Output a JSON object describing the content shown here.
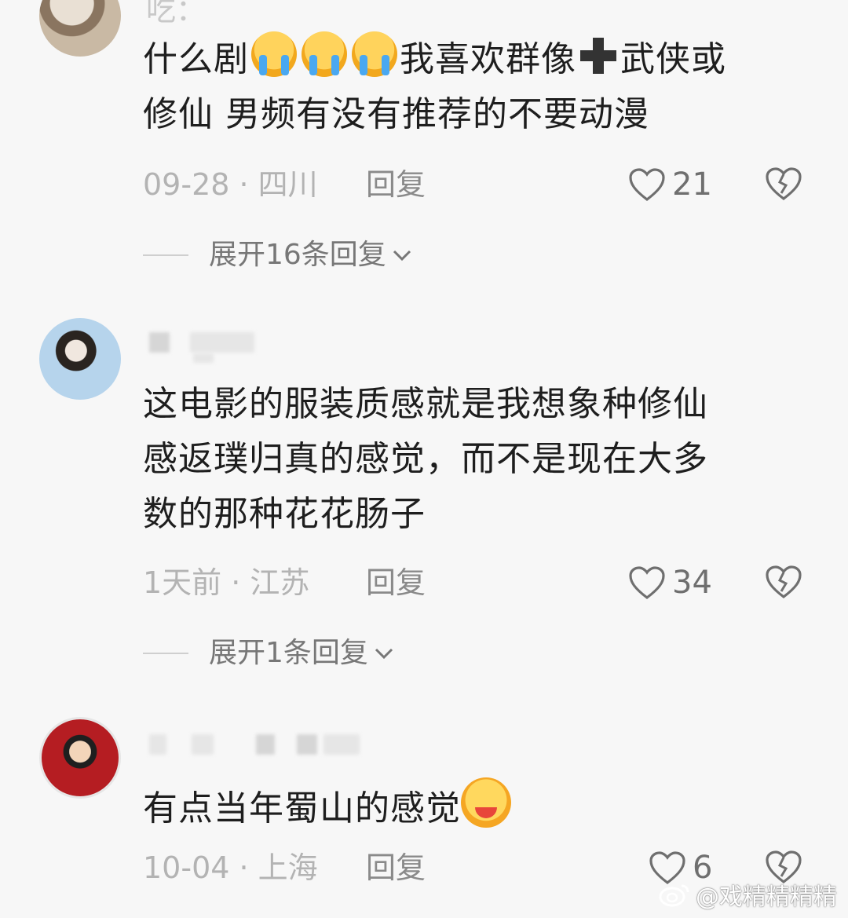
{
  "top_fragment": "吃：",
  "comments": [
    {
      "text_parts": [
        "什么剧",
        "我喜欢群像",
        "武侠或\n修仙 男频有没有推荐的不要动漫"
      ],
      "meta": "09-28 · 四川",
      "reply_label": "回复",
      "likes": "21",
      "expand": "展开16条回复"
    },
    {
      "text": "这电影的服装质感就是我想象种修仙\n感返璞归真的感觉，而不是现在大多\n数的那种花花肠子",
      "meta": "1天前 · 江苏",
      "reply_label": "回复",
      "likes": "34",
      "expand": "展开1条回复"
    },
    {
      "text": "有点当年蜀山的感觉",
      "meta": "10-04 · 上海",
      "reply_label": "回复",
      "likes": "6"
    }
  ],
  "watermark": "@戏精精精精",
  "icons": {
    "like": "heart-outline-icon",
    "dislike": "broken-heart-icon",
    "expand": "chevron-down-icon",
    "watermark": "weibo-logo-icon",
    "emoji_cry": "loudly-crying-face-emoji",
    "emoji_plus": "heavy-plus-emoji",
    "emoji_hug": "hugging-face-emoji"
  },
  "colors": {
    "background": "#f7f7f7",
    "text": "#1e1e1e",
    "meta": "#b3b3b3",
    "reply": "#8a8a8a"
  }
}
